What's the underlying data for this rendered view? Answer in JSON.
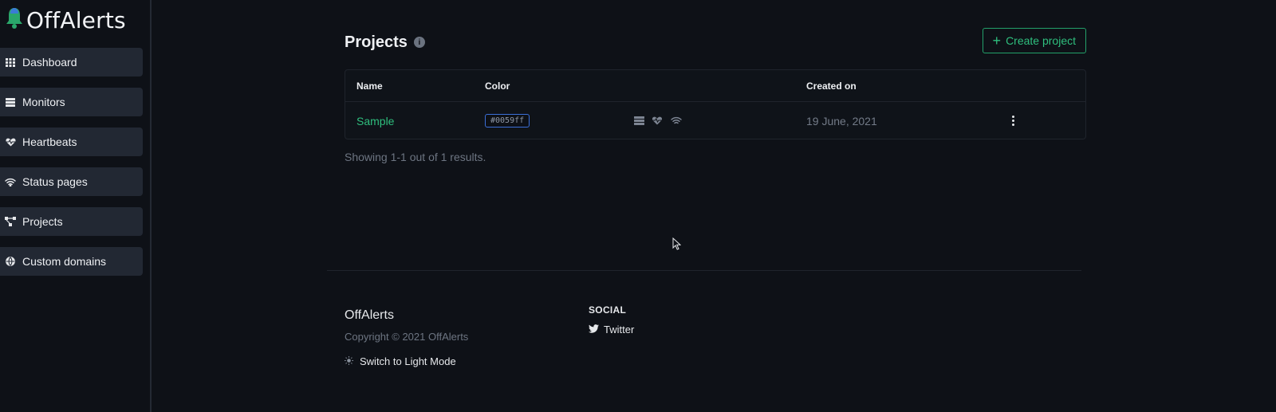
{
  "app": {
    "brand": "OffAlerts"
  },
  "sidebar": {
    "items": [
      {
        "label": "Dashboard",
        "icon": "grid-icon"
      },
      {
        "label": "Monitors",
        "icon": "server-icon"
      },
      {
        "label": "Heartbeats",
        "icon": "heartbeat-icon"
      },
      {
        "label": "Status pages",
        "icon": "wifi-icon"
      },
      {
        "label": "Projects",
        "icon": "project-diagram-icon"
      },
      {
        "label": "Custom domains",
        "icon": "globe-icon"
      }
    ]
  },
  "main": {
    "title": "Projects",
    "create_label": "Create project",
    "table": {
      "columns": [
        "Name",
        "Color",
        "Created on"
      ],
      "rows": [
        {
          "name": "Sample",
          "color": "#0059ff",
          "created": "19 June, 2021"
        }
      ]
    },
    "results_text": "Showing 1-1 out of 1 results."
  },
  "footer": {
    "brand": "OffAlerts",
    "copyright": "Copyright © 2021 OffAlerts",
    "mode_switch": "Switch to Light Mode",
    "social_heading": "SOCIAL",
    "twitter": "Twitter"
  },
  "colors": {
    "accent": "#2fbf7e",
    "background": "#0e1117",
    "nav_bg": "#222833",
    "chip_border": "#3b6fd8"
  }
}
